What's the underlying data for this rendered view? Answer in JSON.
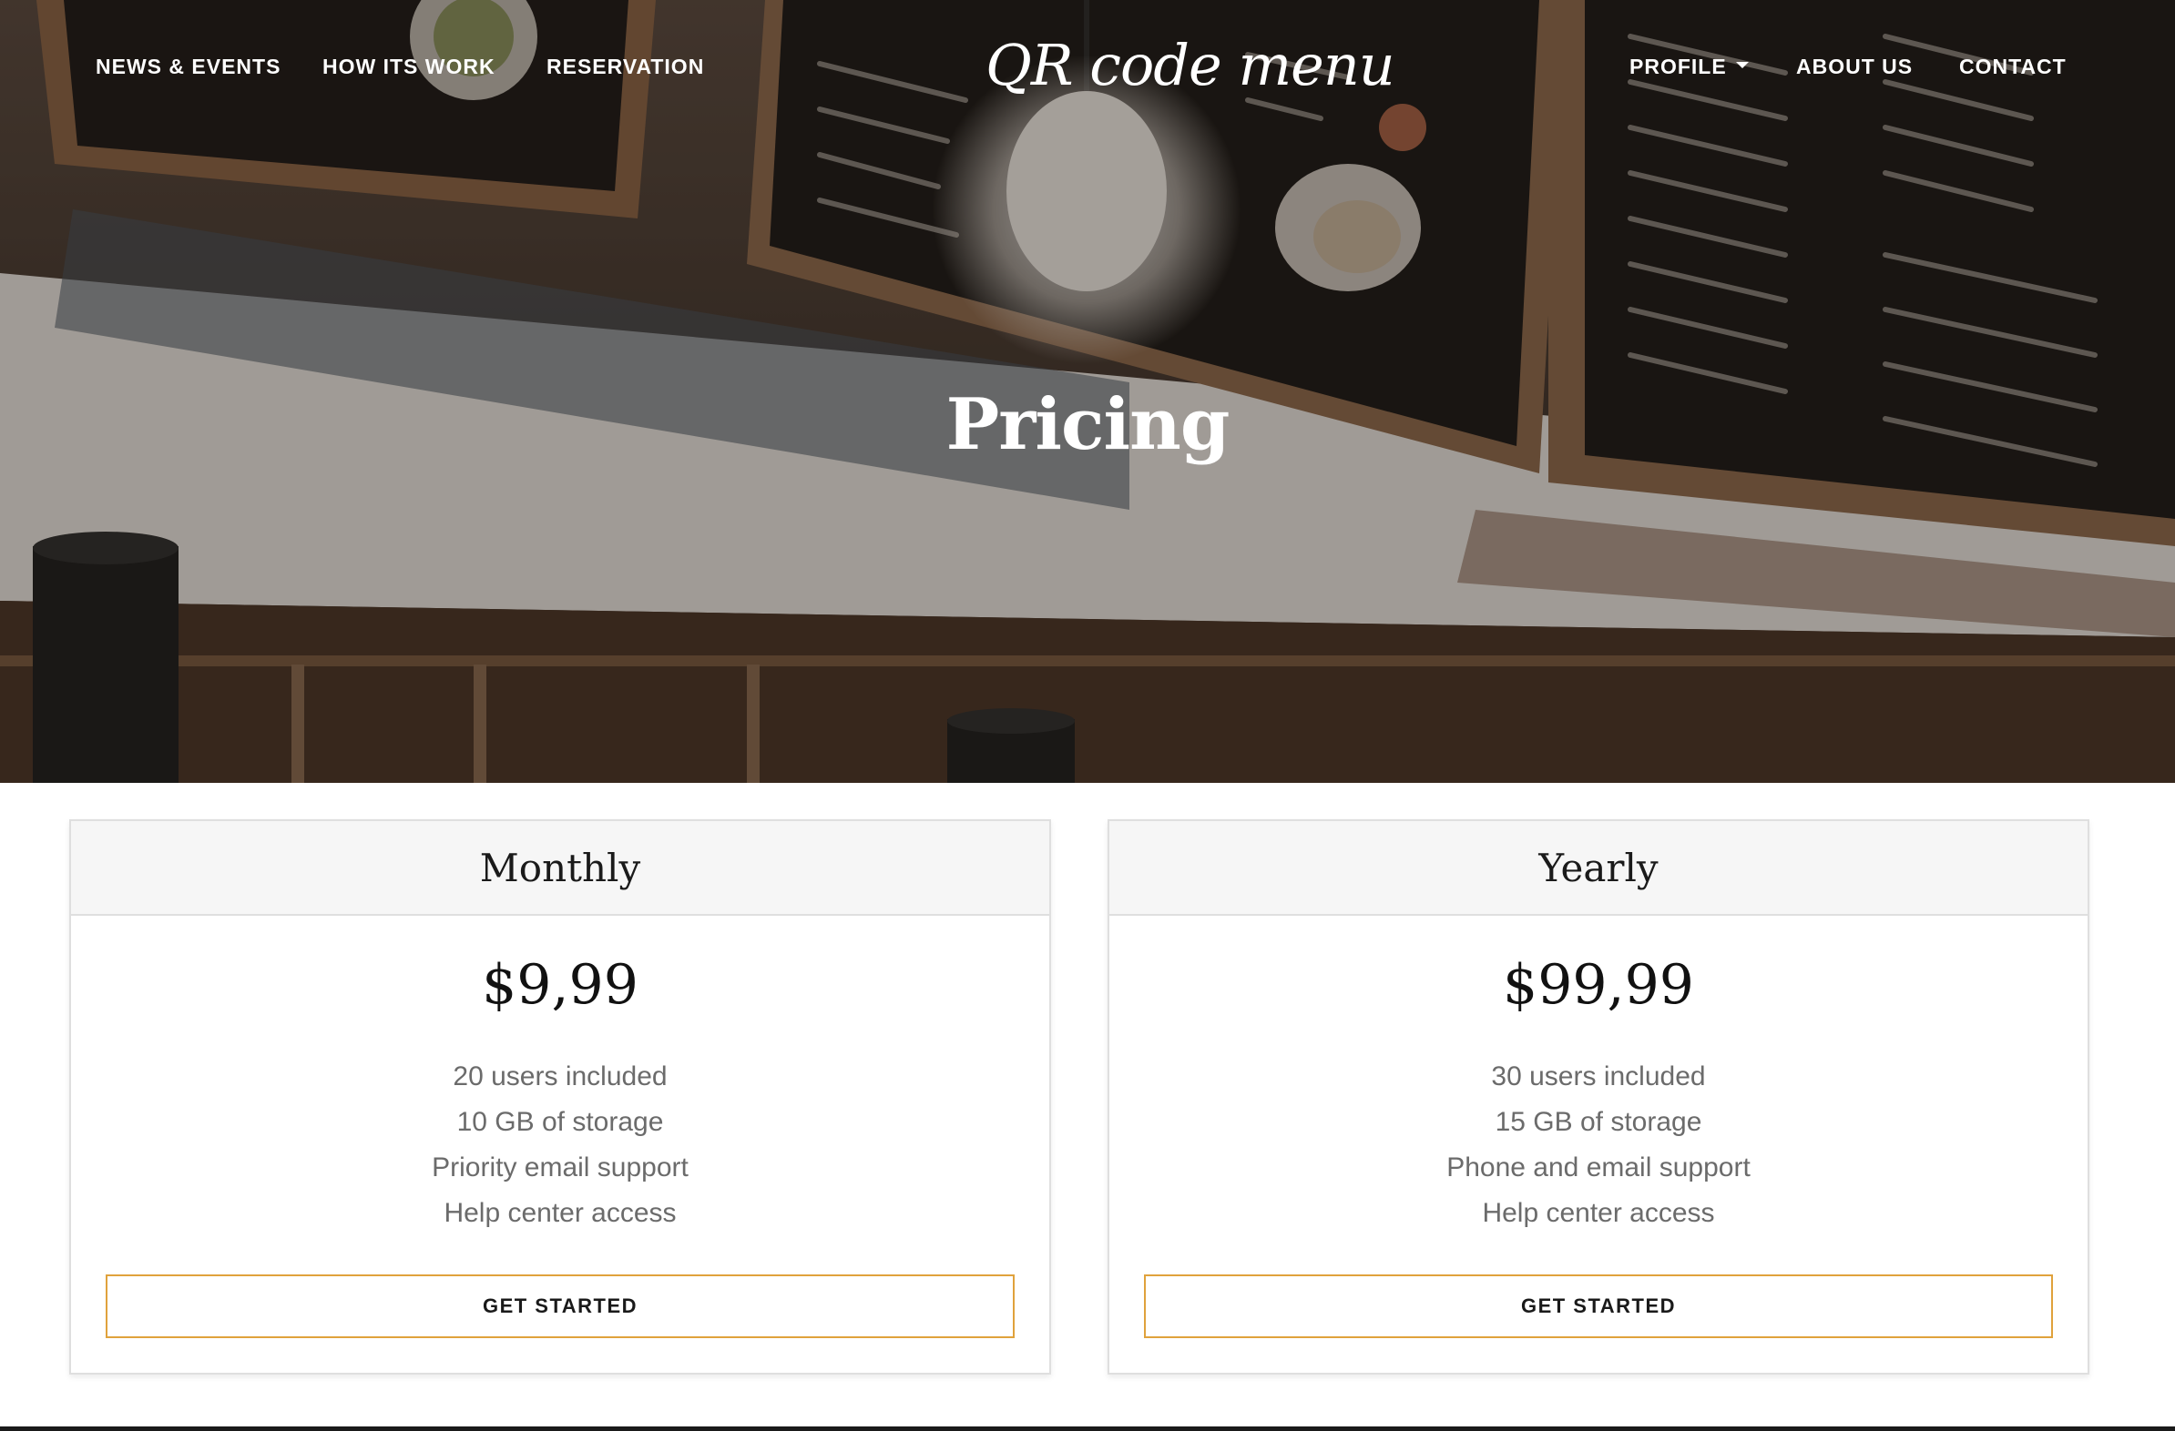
{
  "nav": {
    "left": [
      {
        "label": "NEWS & EVENTS"
      },
      {
        "label": "HOW ITS WORK"
      },
      {
        "label": "RESERVATION"
      }
    ],
    "brand": "QR code menu",
    "right": [
      {
        "label": "PROFILE",
        "icon": "caret-down-icon"
      },
      {
        "label": "ABOUT US"
      },
      {
        "label": "CONTACT"
      }
    ]
  },
  "hero": {
    "title": "Pricing"
  },
  "plans": [
    {
      "name": "Monthly",
      "price": "$9,99",
      "features": [
        "20 users included",
        "10 GB of storage",
        "Priority email support",
        "Help center access"
      ],
      "cta": "GET STARTED"
    },
    {
      "name": "Yearly",
      "price": "$99,99",
      "features": [
        "30 users included",
        "15 GB of storage",
        "Phone and email support",
        "Help center access"
      ],
      "cta": "GET STARTED"
    }
  ],
  "colors": {
    "accent_border": "#e0a23c",
    "card_header_bg": "#f6f6f6",
    "feature_text": "#6b6b6b"
  }
}
